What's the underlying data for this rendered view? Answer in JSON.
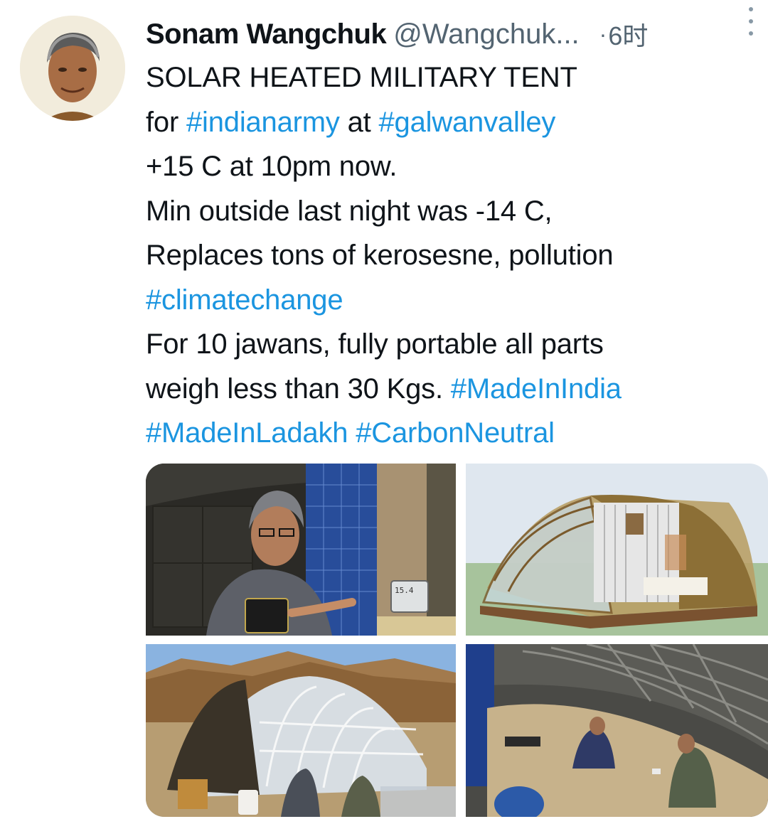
{
  "author": {
    "display_name": "Sonam Wangchuk",
    "handle": "@Wangchuk...",
    "separator": "·",
    "time": "6时"
  },
  "tweet": {
    "lines": [
      [
        {
          "t": "SOLAR HEATED MILITARY TENT"
        }
      ],
      [
        {
          "t": "for "
        },
        {
          "t": "#indianarmy",
          "tag": true
        },
        {
          "t": " at "
        },
        {
          "t": "#galwanvalley",
          "tag": true
        }
      ],
      [
        {
          "t": "+15 C at 10pm now."
        }
      ],
      [
        {
          "t": "Min outside last night was -14 C,"
        }
      ],
      [
        {
          "t": "Replaces tons of kerosesne, pollution"
        }
      ],
      [
        {
          "t": "#climatechange",
          "tag": true
        }
      ],
      [
        {
          "t": "For 10 jawans, fully portable all parts"
        }
      ],
      [
        {
          "t": "weigh less than 30 Kgs. "
        },
        {
          "t": "#MadeInIndia",
          "tag": true
        }
      ],
      [
        {
          "t": "#MadeInLadakh",
          "tag": true
        },
        {
          "t": " "
        },
        {
          "t": "#CarbonNeutral",
          "tag": true
        }
      ]
    ]
  },
  "media": {
    "thermometer_reading": "15.4",
    "items": [
      {
        "name": "photo-man-in-tent-with-thermometer"
      },
      {
        "name": "illustration-tent-3d-model"
      },
      {
        "name": "photo-tent-exterior-mountains"
      },
      {
        "name": "photo-tent-interior-soldiers"
      }
    ]
  },
  "colors": {
    "link": "#1b95e0",
    "text": "#0f1419",
    "secondary": "#536471"
  }
}
